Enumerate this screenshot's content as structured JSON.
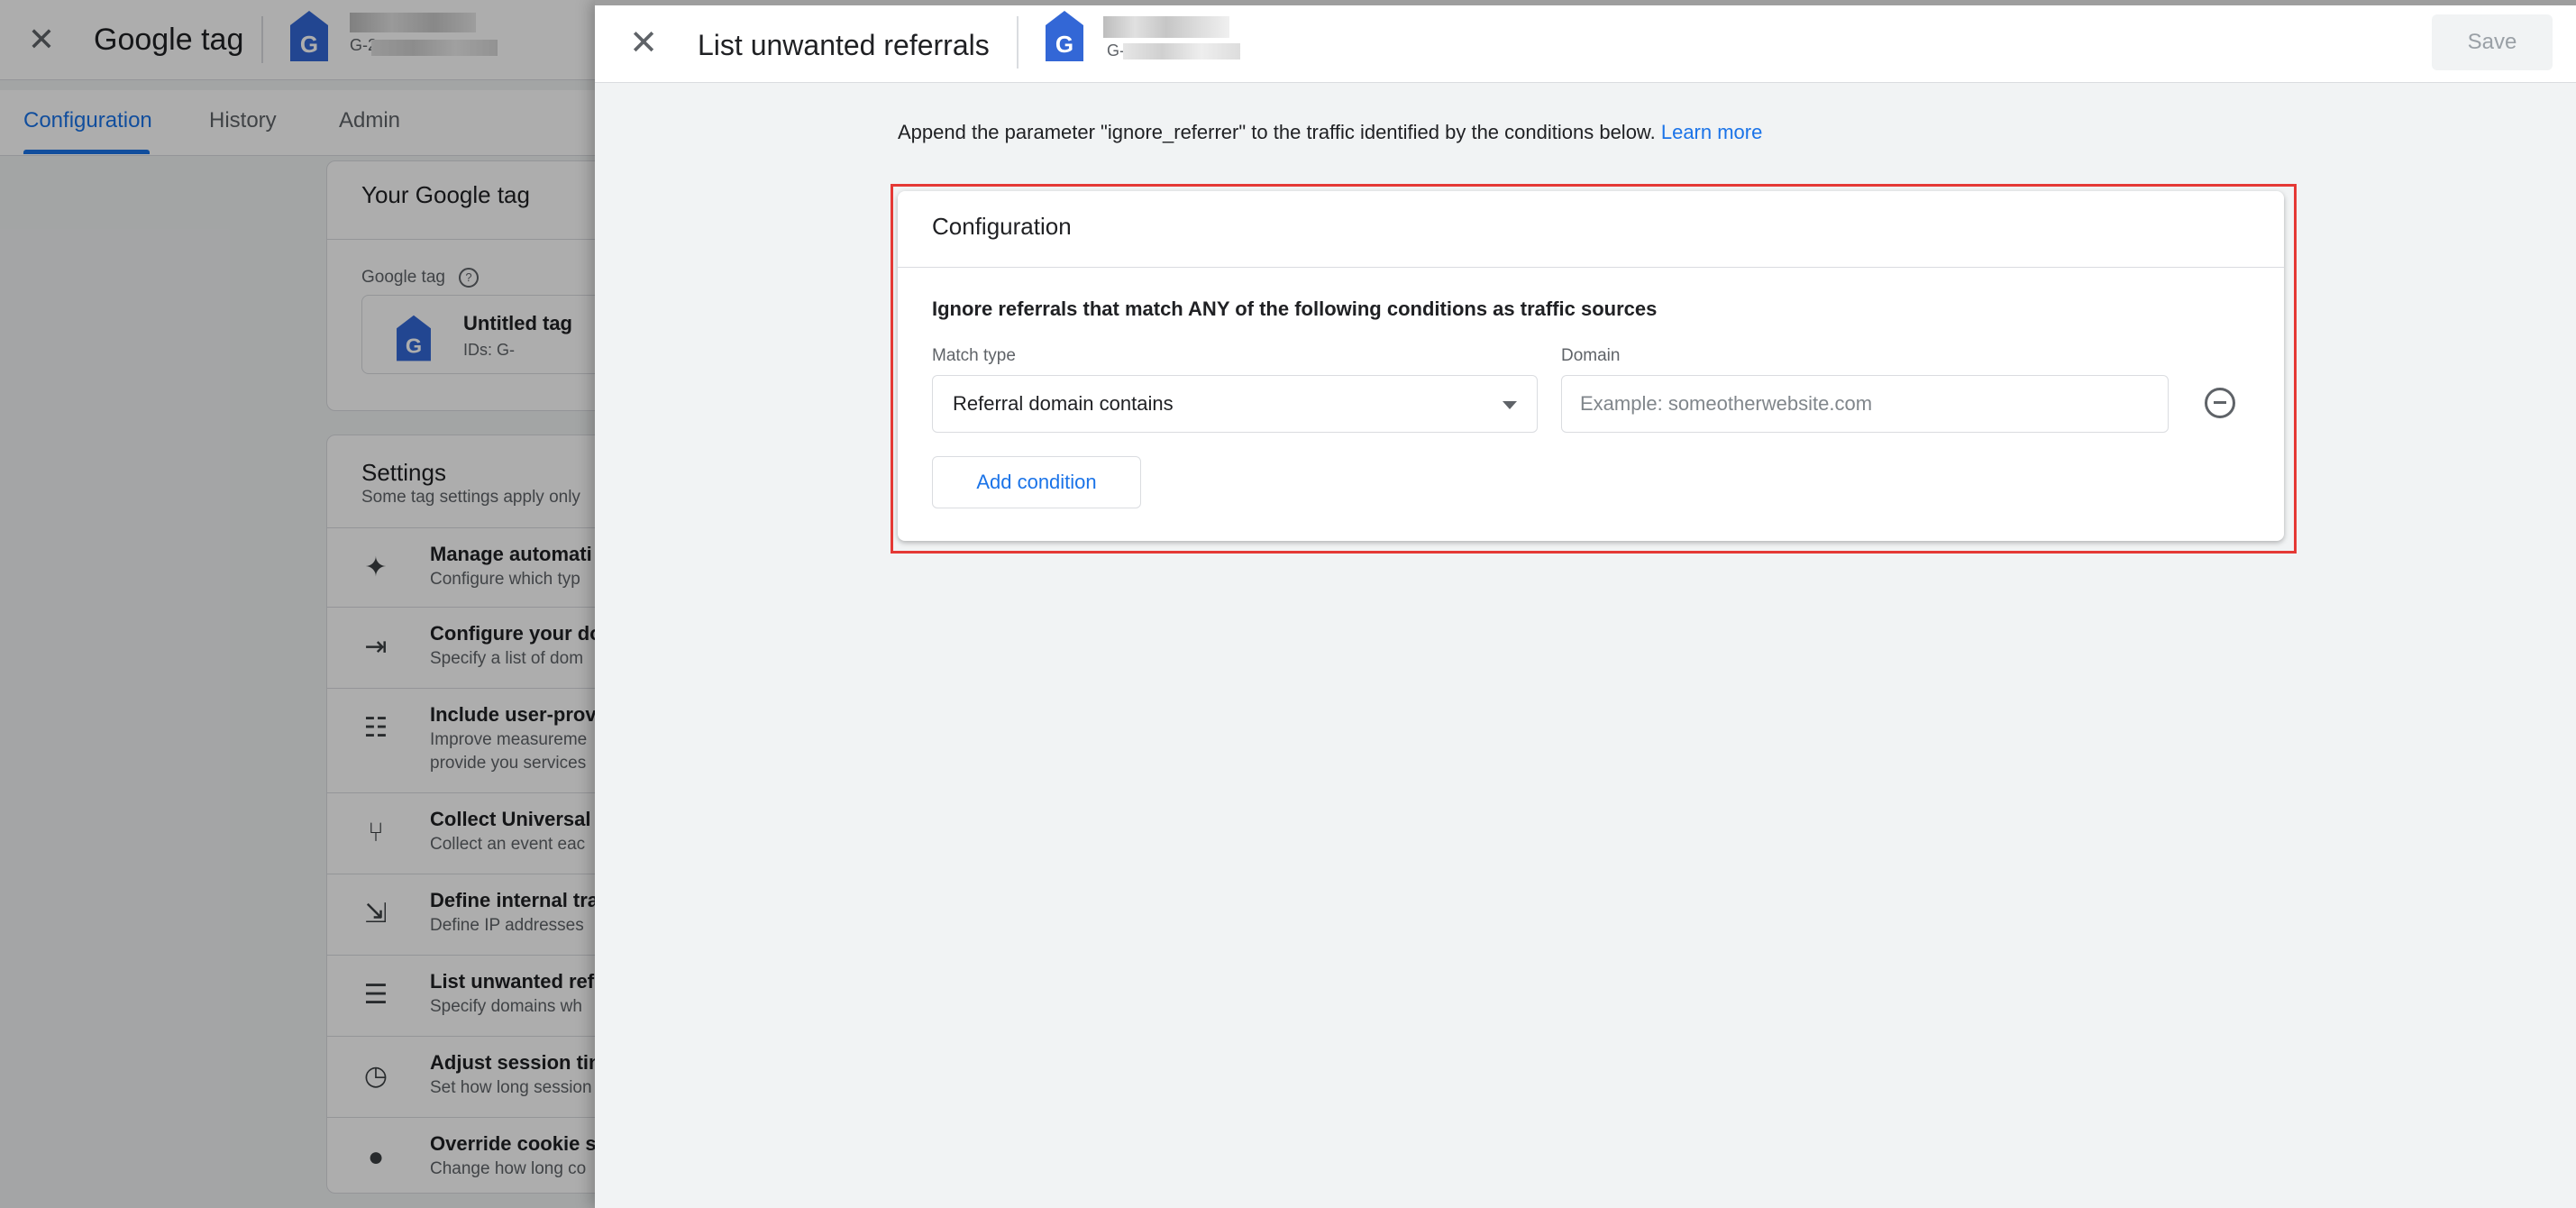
{
  "background_page": {
    "close_icon": "close-icon",
    "title": "Google tag",
    "tag_id": "G-2",
    "tabs": [
      {
        "label": "Configuration",
        "active": true
      },
      {
        "label": "History",
        "active": false
      },
      {
        "label": "Admin",
        "active": false
      }
    ],
    "tag_card": {
      "title": "Your Google tag",
      "label": "Google tag",
      "tag_name": "Untitled tag",
      "tag_ids": "IDs: G-"
    },
    "settings": {
      "title": "Settings",
      "subtitle": "Some tag settings apply only",
      "items": [
        {
          "icon": "sparkle-icon",
          "title": "Manage automati",
          "desc": "Configure which typ"
        },
        {
          "icon": "merge-arrows-icon",
          "title": "Configure your do",
          "desc": "Specify a list of dom"
        },
        {
          "icon": "user-data-icon",
          "title": "Include user-provi",
          "desc": "Improve measureme",
          "desc2": "provide you services"
        },
        {
          "icon": "fork-icon",
          "title": "Collect Universal",
          "desc": "Collect an event eac"
        },
        {
          "icon": "exit-icon",
          "title": "Define internal tra",
          "desc": "Define IP addresses"
        },
        {
          "icon": "list-check-icon",
          "title": "List unwanted ref",
          "desc": "Specify domains wh"
        },
        {
          "icon": "clock-icon",
          "title": "Adjust session tin",
          "desc": "Set how long session"
        },
        {
          "icon": "cookie-icon",
          "title": "Override cookie se",
          "desc": "Change how long co"
        }
      ]
    }
  },
  "panel": {
    "close_icon": "close-icon",
    "title": "List unwanted referrals",
    "tag_id": "G-",
    "save_label": "Save",
    "description": "Append the parameter \"ignore_referrer\" to the traffic identified by the conditions below.",
    "learn_more": "Learn more",
    "config": {
      "title": "Configuration",
      "condition_heading": "Ignore referrals that match ANY of the following conditions as traffic sources",
      "match_type_label": "Match type",
      "match_type_value": "Referral domain contains",
      "domain_label": "Domain",
      "domain_value": "",
      "domain_placeholder": "Example: someotherwebsite.com",
      "add_condition_label": "Add condition"
    }
  },
  "colors": {
    "accent": "#1a73e8",
    "highlight": "#e53935",
    "tag_blue": "#3367d6"
  }
}
